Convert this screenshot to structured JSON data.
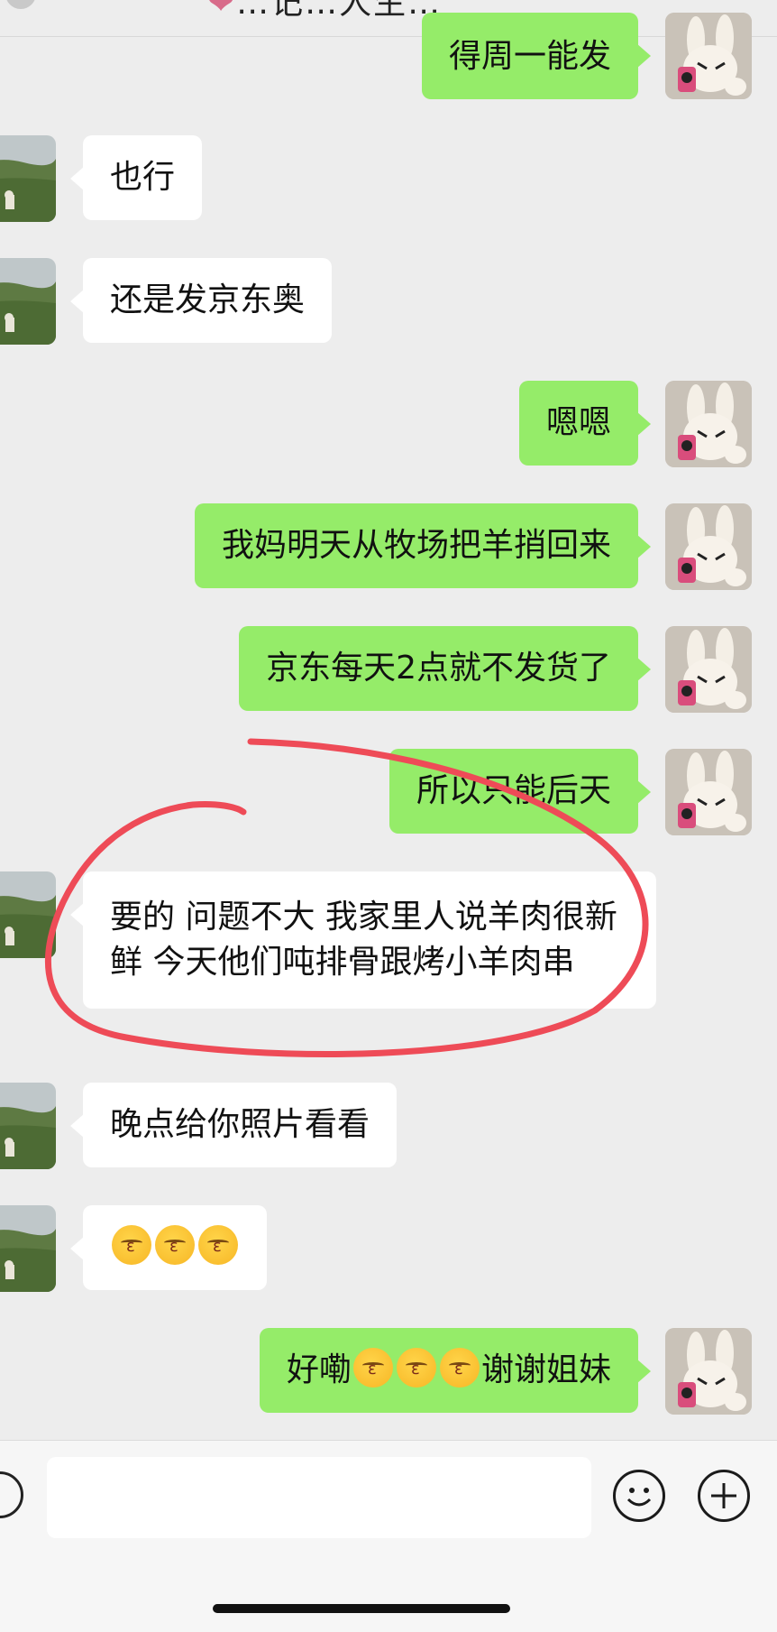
{
  "header": {
    "title": "…记…人生…"
  },
  "messages": [
    {
      "side": "me",
      "text": "得周一能发"
    },
    {
      "side": "them",
      "text": "也行"
    },
    {
      "side": "them",
      "text": "还是发京东奥"
    },
    {
      "side": "me",
      "text": "嗯嗯"
    },
    {
      "side": "me",
      "text": "我妈明天从牧场把羊捎回来"
    },
    {
      "side": "me",
      "text": "京东每天2点就不发货了"
    },
    {
      "side": "me",
      "text": "所以只能后天"
    },
    {
      "side": "them",
      "text": "要的 问题不大 我家里人说羊肉很新鲜 今天他们吨排骨跟烤小羊肉串"
    },
    {
      "side": "them",
      "text": "晚点给你照片看看"
    },
    {
      "side": "them",
      "emoji": "kissing-face-icon",
      "emoji_count": 3
    },
    {
      "side": "me",
      "text_before": "好嘞",
      "emoji": "kissing-face-icon",
      "emoji_count": 3,
      "text_after": "谢谢姐妹"
    }
  ],
  "input_bar": {
    "value": "",
    "placeholder": ""
  },
  "icons": {
    "voice": "voice-icon",
    "sticker": "smiley-icon",
    "more": "plus-icon"
  },
  "colors": {
    "background": "#ededed",
    "my_bubble": "#95ec69",
    "their_bubble": "#ffffff",
    "annotation": "#ee4b57"
  }
}
